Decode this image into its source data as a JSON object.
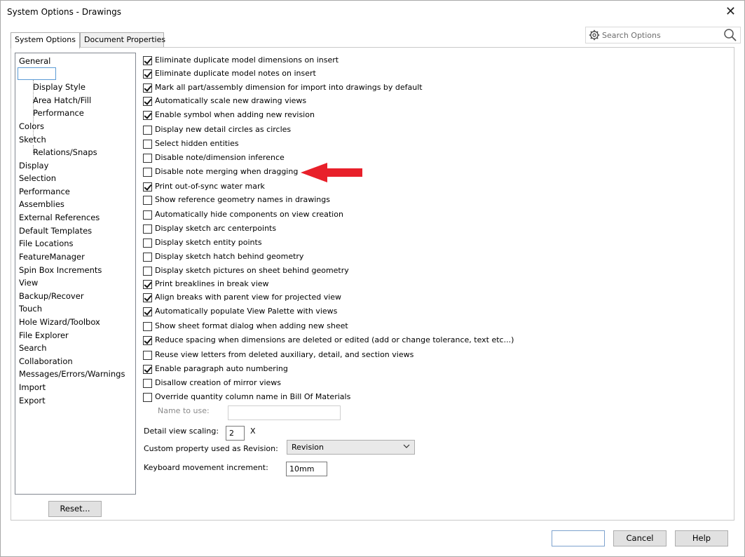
{
  "window": {
    "title": "System Options - Drawings"
  },
  "tabs": [
    {
      "label": "System Options"
    },
    {
      "label": "Document Properties"
    }
  ],
  "search": {
    "placeholder": "Search Options"
  },
  "tree": {
    "items": [
      {
        "label": "General",
        "level": 0
      },
      {
        "label": "",
        "level": 0,
        "selected": true
      },
      {
        "label": "Display Style",
        "level": 1
      },
      {
        "label": "Area Hatch/Fill",
        "level": 1
      },
      {
        "label": "Performance",
        "level": 1
      },
      {
        "label": "Colors",
        "level": 0
      },
      {
        "label": "Sketch",
        "level": 0
      },
      {
        "label": "Relations/Snaps",
        "level": 1
      },
      {
        "label": "Display",
        "level": 0
      },
      {
        "label": "Selection",
        "level": 0
      },
      {
        "label": "Performance",
        "level": 0
      },
      {
        "label": "Assemblies",
        "level": 0
      },
      {
        "label": "External References",
        "level": 0
      },
      {
        "label": "Default Templates",
        "level": 0
      },
      {
        "label": "File Locations",
        "level": 0
      },
      {
        "label": "FeatureManager",
        "level": 0
      },
      {
        "label": "Spin Box Increments",
        "level": 0
      },
      {
        "label": "View",
        "level": 0
      },
      {
        "label": "Backup/Recover",
        "level": 0
      },
      {
        "label": "Touch",
        "level": 0
      },
      {
        "label": "Hole Wizard/Toolbox",
        "level": 0
      },
      {
        "label": "File Explorer",
        "level": 0
      },
      {
        "label": "Search",
        "level": 0
      },
      {
        "label": "Collaboration",
        "level": 0
      },
      {
        "label": "Messages/Errors/Warnings",
        "level": 0
      },
      {
        "label": "Import",
        "level": 0
      },
      {
        "label": "Export",
        "level": 0
      }
    ]
  },
  "options": [
    {
      "label": "Eliminate duplicate model dimensions on insert",
      "checked": true
    },
    {
      "label": "Eliminate duplicate model notes on insert",
      "checked": true
    },
    {
      "label": "Mark all part/assembly dimension for import into drawings by default",
      "checked": true
    },
    {
      "label": "Automatically scale new drawing views",
      "checked": true
    },
    {
      "label": "Enable symbol when adding new revision",
      "checked": true
    },
    {
      "label": "Display new detail circles as circles",
      "checked": false
    },
    {
      "label": "Select hidden entities",
      "checked": false
    },
    {
      "label": "Disable note/dimension inference",
      "checked": false
    },
    {
      "label": "Disable note merging when dragging",
      "checked": false
    },
    {
      "label": "Print out-of-sync water mark",
      "checked": true
    },
    {
      "label": "Show reference geometry names in drawings",
      "checked": false
    },
    {
      "label": "Automatically hide components on view creation",
      "checked": false
    },
    {
      "label": "Display sketch arc centerpoints",
      "checked": false
    },
    {
      "label": "Display sketch entity points",
      "checked": false
    },
    {
      "label": "Display sketch hatch behind geometry",
      "checked": false
    },
    {
      "label": "Display sketch pictures on sheet behind geometry",
      "checked": false
    },
    {
      "label": "Print breaklines in break view",
      "checked": true
    },
    {
      "label": "Align breaks with parent view for projected view",
      "checked": true
    },
    {
      "label": "Automatically populate View Palette with views",
      "checked": true
    },
    {
      "label": "Show sheet format dialog when adding new sheet",
      "checked": false
    },
    {
      "label": "Reduce spacing when dimensions are deleted or edited (add or change tolerance, text etc...)",
      "checked": true
    },
    {
      "label": "Reuse view letters from deleted auxiliary, detail, and section views",
      "checked": false
    },
    {
      "label": "Enable paragraph auto numbering",
      "checked": true
    },
    {
      "label": "Disallow creation of mirror views",
      "checked": false
    },
    {
      "label": "Override quantity column name in Bill Of Materials",
      "checked": false
    }
  ],
  "name_to_use": {
    "label": "Name to use:",
    "value": ""
  },
  "detail_scaling": {
    "label": "Detail view scaling:",
    "value": "2",
    "unit": "X"
  },
  "custom_property": {
    "label": "Custom property used as Revision:",
    "value": "Revision"
  },
  "keyboard_increment": {
    "label": "Keyboard movement increment:",
    "value": "10mm"
  },
  "buttons": {
    "reset": "Reset...",
    "ok": "",
    "cancel": "Cancel",
    "help": "Help"
  },
  "annotation": {
    "arrow_color": "#e8202a"
  }
}
